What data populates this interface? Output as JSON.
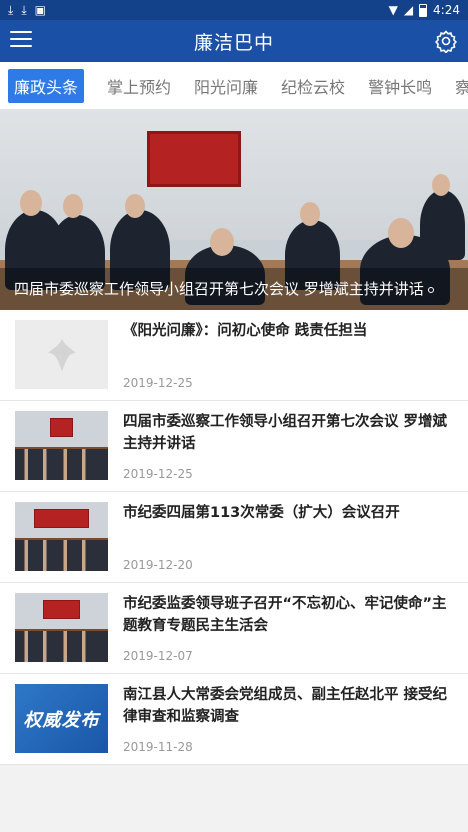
{
  "status_bar": {
    "time": "4:24",
    "left_icons": [
      "download-icon",
      "download-icon",
      "image-icon"
    ]
  },
  "app_bar": {
    "title": "廉洁巴中"
  },
  "tabs": [
    {
      "label": "廉政头条",
      "active": true
    },
    {
      "label": "掌上预约",
      "active": false
    },
    {
      "label": "阳光问廉",
      "active": false
    },
    {
      "label": "纪检云校",
      "active": false
    },
    {
      "label": "警钟长鸣",
      "active": false
    },
    {
      "label": "察",
      "active": false
    }
  ],
  "banner": {
    "caption": "四届市委巡察工作领导小组召开第七次会议 罗增斌主持并讲话"
  },
  "news": [
    {
      "title": "《阳光问廉》：问初心使命 践责任担当",
      "date": "2019-12-25",
      "thumb": "placeholder"
    },
    {
      "title": "四届市委巡察工作领导小组召开第七次会议 罗增斌主持并讲话",
      "date": "2019-12-25",
      "thumb": "meeting"
    },
    {
      "title": "市纪委四届第113次常委（扩大）会议召开",
      "date": "2019-12-20",
      "thumb": "meeting"
    },
    {
      "title": "市纪委监委领导班子召开“不忘初心、牢记使命”主题教育专题民主生活会",
      "date": "2019-12-07",
      "thumb": "meeting"
    },
    {
      "title": "南江县人大常委会党组成员、副主任赵北平 接受纪律审查和监察调查",
      "date": "2019-11-28",
      "thumb": "brand",
      "thumb_text": "权威发布"
    }
  ],
  "colors": {
    "app_bar": "#1a50a6",
    "status_bar": "#14428a",
    "active_tab": "#2e7be8"
  }
}
